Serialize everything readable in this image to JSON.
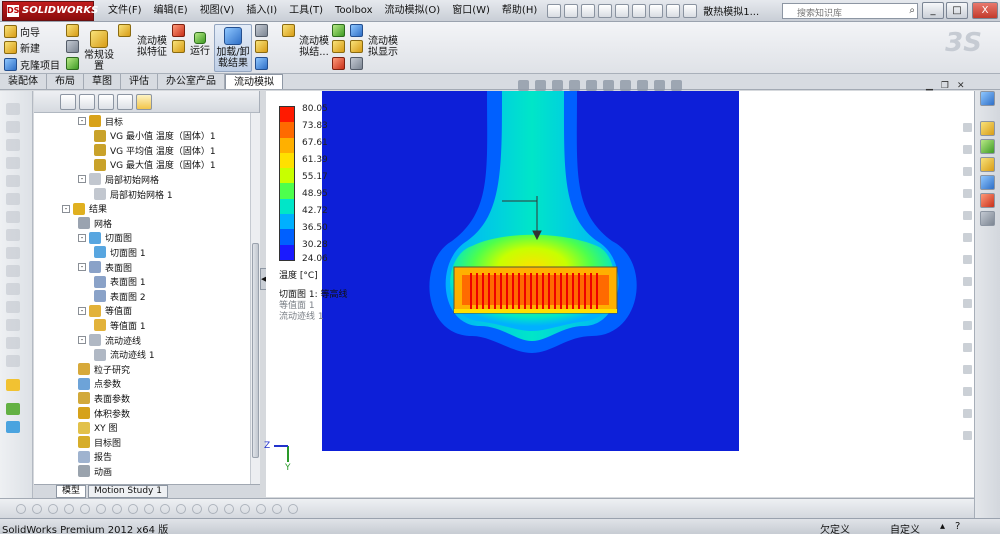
{
  "app": {
    "logo": "SOLIDWORKS",
    "doc_title": "散热模拟1...",
    "search_placeholder": "搜索知识库"
  },
  "menu": [
    "文件(F)",
    "编辑(E)",
    "视图(V)",
    "插入(I)",
    "工具(T)",
    "Toolbox",
    "流动模拟(O)",
    "窗口(W)",
    "帮助(H)"
  ],
  "window_buttons": {
    "min": "_",
    "restore": "□",
    "close": "X"
  },
  "command_manager": {
    "wizard": "向导",
    "new": "新建",
    "clone": "克隆项目",
    "general": "常规设置",
    "flow_feature": "流动模拟特征",
    "run": "运行",
    "load_results": "加载/卸载结果",
    "flow_results": "流动模拟结...",
    "flow_display": "流动模拟显示"
  },
  "tabs": [
    {
      "label": "装配体",
      "active": false
    },
    {
      "label": "布局",
      "active": false
    },
    {
      "label": "草图",
      "active": false
    },
    {
      "label": "评估",
      "active": false
    },
    {
      "label": "办公室产品",
      "active": false
    },
    {
      "label": "流动模拟",
      "active": true
    }
  ],
  "tree": [
    {
      "label": "目标",
      "level": 1,
      "exp": "-",
      "icon": "goals-icon",
      "color": "#d8a21a"
    },
    {
      "label": "VG 最小值 温度（固体）1",
      "level": 2,
      "icon": "goal-icon",
      "color": "#c9a22a"
    },
    {
      "label": "VG 平均值 温度（固体）1",
      "level": 2,
      "icon": "goal-icon",
      "color": "#c9a22a"
    },
    {
      "label": "VG 最大值 温度（固体）1",
      "level": 2,
      "icon": "goal-icon",
      "color": "#c9a22a"
    },
    {
      "label": "局部初始网格",
      "level": 1,
      "exp": "-",
      "icon": "mesh-icon",
      "color": "#c2c7cf"
    },
    {
      "label": "局部初始网格 1",
      "level": 2,
      "icon": "mesh-icon",
      "color": "#c2c7cf"
    },
    {
      "label": "结果",
      "level": 0,
      "exp": "-",
      "icon": "results-icon",
      "color": "#e0b020"
    },
    {
      "label": "网格",
      "level": 1,
      "icon": "grid-icon",
      "color": "#9aa3b0"
    },
    {
      "label": "切面图",
      "level": 1,
      "exp": "-",
      "icon": "cut-plot-icon",
      "color": "#58a6e0"
    },
    {
      "label": "切面图 1",
      "level": 2,
      "icon": "cut-plot-icon",
      "color": "#58a6e0"
    },
    {
      "label": "表面图",
      "level": 1,
      "exp": "-",
      "icon": "surface-plot-icon",
      "color": "#8aa2c8"
    },
    {
      "label": "表面图 1",
      "level": 2,
      "icon": "surface-plot-icon",
      "color": "#8aa2c8"
    },
    {
      "label": "表面图 2",
      "level": 2,
      "icon": "surface-plot-icon",
      "color": "#8aa2c8"
    },
    {
      "label": "等值面",
      "level": 1,
      "exp": "-",
      "icon": "isosurface-icon",
      "color": "#e2b23a"
    },
    {
      "label": "等值面 1",
      "level": 2,
      "icon": "isosurface-icon",
      "color": "#e2b23a"
    },
    {
      "label": "流动迹线",
      "level": 1,
      "exp": "-",
      "icon": "flow-trajectory-icon",
      "color": "#b0b8c4"
    },
    {
      "label": "流动迹线 1",
      "level": 2,
      "icon": "flow-trajectory-icon",
      "color": "#b0b8c4"
    },
    {
      "label": "粒子研究",
      "level": 1,
      "icon": "particle-icon",
      "color": "#d7a93a"
    },
    {
      "label": "点参数",
      "level": 1,
      "icon": "point-param-icon",
      "color": "#6da3d8"
    },
    {
      "label": "表面参数",
      "level": 1,
      "icon": "surface-param-icon",
      "color": "#d2a93a"
    },
    {
      "label": "体积参数",
      "level": 1,
      "icon": "volume-param-icon",
      "color": "#d6a21a"
    },
    {
      "label": "XY 图",
      "level": 1,
      "icon": "xy-plot-icon",
      "color": "#e2c14a"
    },
    {
      "label": "目标图",
      "level": 1,
      "icon": "goal-plot-icon",
      "color": "#d6ad2a"
    },
    {
      "label": "报告",
      "level": 1,
      "icon": "report-icon",
      "color": "#9fb3cf"
    },
    {
      "label": "动画",
      "level": 1,
      "icon": "animation-icon",
      "color": "#9aa3ad"
    }
  ],
  "model_tabs": [
    {
      "label": "模型",
      "active": true
    },
    {
      "label": "Motion Study 1",
      "active": false
    }
  ],
  "legend": {
    "values": [
      "80.05",
      "73.83",
      "67.61",
      "61.39",
      "55.17",
      "48.95",
      "42.72",
      "36.50",
      "30.28",
      "24.06"
    ],
    "colors": [
      "#ff1a00",
      "#ff6a00",
      "#ffb000",
      "#ffe000",
      "#c8ff00",
      "#4dff4d",
      "#00e6c8",
      "#00b0ff",
      "#0060ff",
      "#1a1aff"
    ],
    "title": "温度 [°C]"
  },
  "plot_info": {
    "line1": "切面图 1: 等高线",
    "line2": "等值面 1",
    "line3": "流动迹线 1"
  },
  "status": {
    "left": "SolidWorks Premium 2012 x64 版",
    "undefined": "欠定义",
    "custom": "自定义"
  },
  "triad": {
    "z": "Z",
    "y": "Y"
  }
}
